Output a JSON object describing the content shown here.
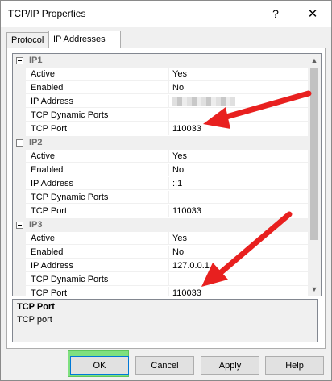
{
  "window": {
    "title": "TCP/IP Properties",
    "help_label": "?",
    "close_label": "✕"
  },
  "tabs": [
    {
      "label": "Protocol",
      "active": false
    },
    {
      "label": "IP Addresses",
      "active": true
    }
  ],
  "groups": [
    {
      "name": "IP1",
      "props": [
        {
          "name": "Active",
          "value": "Yes"
        },
        {
          "name": "Enabled",
          "value": "No"
        },
        {
          "name": "IP Address",
          "value": "",
          "blurred": true
        },
        {
          "name": "TCP Dynamic Ports",
          "value": ""
        },
        {
          "name": "TCP Port",
          "value": "110033"
        }
      ]
    },
    {
      "name": "IP2",
      "props": [
        {
          "name": "Active",
          "value": "Yes"
        },
        {
          "name": "Enabled",
          "value": "No"
        },
        {
          "name": "IP Address",
          "value": "::1"
        },
        {
          "name": "TCP Dynamic Ports",
          "value": ""
        },
        {
          "name": "TCP Port",
          "value": "110033"
        }
      ]
    },
    {
      "name": "IP3",
      "props": [
        {
          "name": "Active",
          "value": "Yes"
        },
        {
          "name": "Enabled",
          "value": "No"
        },
        {
          "name": "IP Address",
          "value": "127.0.0.1"
        },
        {
          "name": "TCP Dynamic Ports",
          "value": ""
        },
        {
          "name": "TCP Port",
          "value": "110033"
        }
      ]
    }
  ],
  "description": {
    "title": "TCP Port",
    "text": "TCP port"
  },
  "buttons": {
    "ok": "OK",
    "cancel": "Cancel",
    "apply": "Apply",
    "help": "Help"
  },
  "colors": {
    "arrow": "#e8201f",
    "ok_highlight": "#7fe07f"
  }
}
